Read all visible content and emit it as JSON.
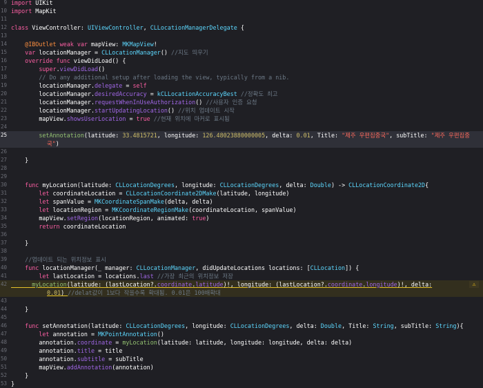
{
  "editor": {
    "lines": [
      {
        "n": "9",
        "t": [
          [
            "kw",
            "import"
          ],
          [
            "pl",
            " UIKit"
          ]
        ]
      },
      {
        "n": "10",
        "t": [
          [
            "kw",
            "import"
          ],
          [
            "pl",
            " MapKit"
          ]
        ]
      },
      {
        "n": "11",
        "t": []
      },
      {
        "n": "12",
        "t": [
          [
            "kw",
            "class"
          ],
          [
            "pl",
            " ViewController: "
          ],
          [
            "ty",
            "UIViewController"
          ],
          [
            "pl",
            ", "
          ],
          [
            "ty",
            "CLLocationManagerDelegate"
          ],
          [
            "pl",
            " {"
          ]
        ]
      },
      {
        "n": "13",
        "t": []
      },
      {
        "n": "14",
        "t": [
          [
            "pl",
            "    "
          ],
          [
            "attr",
            "@IBOutlet"
          ],
          [
            "pl",
            " "
          ],
          [
            "kw",
            "weak"
          ],
          [
            "pl",
            " "
          ],
          [
            "kw",
            "var"
          ],
          [
            "pl",
            " mapView: "
          ],
          [
            "ty",
            "MKMapView"
          ],
          [
            "pl",
            "!"
          ]
        ]
      },
      {
        "n": "15",
        "t": [
          [
            "pl",
            "    "
          ],
          [
            "kw",
            "var"
          ],
          [
            "pl",
            " locationManager = "
          ],
          [
            "ty",
            "CLLocationManager"
          ],
          [
            "pl",
            "() "
          ],
          [
            "cm",
            "//지도 띄우기"
          ]
        ]
      },
      {
        "n": "16",
        "t": [
          [
            "pl",
            "    "
          ],
          [
            "kw",
            "override"
          ],
          [
            "pl",
            " "
          ],
          [
            "kw",
            "func"
          ],
          [
            "pl",
            " viewDidLoad() {"
          ]
        ]
      },
      {
        "n": "17",
        "t": [
          [
            "pl",
            "        "
          ],
          [
            "kw",
            "super"
          ],
          [
            "pl",
            "."
          ],
          [
            "pr",
            "viewDidLoad"
          ],
          [
            "pl",
            "()"
          ]
        ]
      },
      {
        "n": "18",
        "t": [
          [
            "pl",
            "        "
          ],
          [
            "cm",
            "// Do any additional setup after loading the view, typically from a nib."
          ]
        ]
      },
      {
        "n": "19",
        "t": [
          [
            "pl",
            "        locationManager."
          ],
          [
            "pr",
            "delegate"
          ],
          [
            "pl",
            " = "
          ],
          [
            "kw",
            "self"
          ]
        ]
      },
      {
        "n": "20",
        "t": [
          [
            "pl",
            "        locationManager."
          ],
          [
            "pr",
            "desiredAccuracy"
          ],
          [
            "pl",
            " = "
          ],
          [
            "ty",
            "kCLLocationAccuracyBest"
          ],
          [
            "pl",
            " "
          ],
          [
            "cm",
            "//정확도 최고"
          ]
        ]
      },
      {
        "n": "21",
        "t": [
          [
            "pl",
            "        locationManager."
          ],
          [
            "pr",
            "requestWhenInUseAuthorization"
          ],
          [
            "pl",
            "() "
          ],
          [
            "cm",
            "//사용자 인증 요청"
          ]
        ]
      },
      {
        "n": "22",
        "t": [
          [
            "pl",
            "        locationManager."
          ],
          [
            "pr",
            "startUpdatingLocation"
          ],
          [
            "pl",
            "() "
          ],
          [
            "cm",
            "//위치 업데이트 시작"
          ]
        ]
      },
      {
        "n": "23",
        "t": [
          [
            "pl",
            "        mapView."
          ],
          [
            "pr",
            "showsUserLocation"
          ],
          [
            "pl",
            " = "
          ],
          [
            "kw",
            "true"
          ],
          [
            "pl",
            " "
          ],
          [
            "cm",
            "//현재 위치에 마커로 표시됨"
          ]
        ]
      },
      {
        "n": "24",
        "t": []
      },
      {
        "n": "25",
        "current": true,
        "t": [
          [
            "pl",
            "        "
          ],
          [
            "ck",
            "setAnnotation"
          ],
          [
            "pl",
            "(latitude: "
          ],
          [
            "num",
            "33.4815721"
          ],
          [
            "pl",
            ", longitude: "
          ],
          [
            "num",
            "126.48023880000005"
          ],
          [
            "pl",
            ", delta: "
          ],
          [
            "num",
            "0.01"
          ],
          [
            "pl",
            ", Title: "
          ],
          [
            "str",
            "\"제주 우편집중국\""
          ],
          [
            "pl",
            ", subTitle: "
          ],
          [
            "str",
            "\"제주 우편집중"
          ]
        ]
      },
      {
        "n": "",
        "current": true,
        "wrap": true,
        "t": [
          [
            "str",
            "국\""
          ],
          [
            "pl",
            ")"
          ]
        ]
      },
      {
        "n": "26",
        "t": []
      },
      {
        "n": "27",
        "t": [
          [
            "pl",
            "    }"
          ]
        ]
      },
      {
        "n": "28",
        "t": []
      },
      {
        "n": "29",
        "t": []
      },
      {
        "n": "30",
        "t": [
          [
            "pl",
            "    "
          ],
          [
            "kw",
            "func"
          ],
          [
            "pl",
            " myLocation(latitude: "
          ],
          [
            "ty",
            "CLLocationDegrees"
          ],
          [
            "pl",
            ", longitude: "
          ],
          [
            "ty",
            "CLLocationDegrees"
          ],
          [
            "pl",
            ", delta: "
          ],
          [
            "ty",
            "Double"
          ],
          [
            "pl",
            ") -> "
          ],
          [
            "ty",
            "CLLocationCoordinate2D"
          ],
          [
            "pl",
            "{"
          ]
        ]
      },
      {
        "n": "31",
        "t": [
          [
            "pl",
            "        "
          ],
          [
            "kw",
            "let"
          ],
          [
            "pl",
            " coordinateLocation = "
          ],
          [
            "ty",
            "CLLocationCoordinate2DMake"
          ],
          [
            "pl",
            "(latitude, longitude)"
          ]
        ]
      },
      {
        "n": "32",
        "t": [
          [
            "pl",
            "        "
          ],
          [
            "kw",
            "let"
          ],
          [
            "pl",
            " spanValue = "
          ],
          [
            "ty",
            "MKCoordinateSpanMake"
          ],
          [
            "pl",
            "(delta, delta)"
          ]
        ]
      },
      {
        "n": "33",
        "t": [
          [
            "pl",
            "        "
          ],
          [
            "kw",
            "let"
          ],
          [
            "pl",
            " locationRegion = "
          ],
          [
            "ty",
            "MKCoordinateRegionMake"
          ],
          [
            "pl",
            "(coordinateLocation, spanValue)"
          ]
        ]
      },
      {
        "n": "34",
        "t": [
          [
            "pl",
            "        mapView."
          ],
          [
            "pr",
            "setRegion"
          ],
          [
            "pl",
            "(locationRegion, animated: "
          ],
          [
            "kw",
            "true"
          ],
          [
            "pl",
            ")"
          ]
        ]
      },
      {
        "n": "35",
        "t": [
          [
            "pl",
            "        "
          ],
          [
            "kw",
            "return"
          ],
          [
            "pl",
            " coordinateLocation"
          ]
        ]
      },
      {
        "n": "36",
        "t": []
      },
      {
        "n": "37",
        "t": [
          [
            "pl",
            "    }"
          ]
        ]
      },
      {
        "n": "38",
        "t": []
      },
      {
        "n": "39",
        "t": [
          [
            "pl",
            "    "
          ],
          [
            "cm",
            "//업데이트 되는 위치정보 표시"
          ]
        ]
      },
      {
        "n": "40",
        "t": [
          [
            "pl",
            "    "
          ],
          [
            "kw",
            "func"
          ],
          [
            "pl",
            " locationManager(_ manager: "
          ],
          [
            "ty",
            "CLLocationManager"
          ],
          [
            "pl",
            ", didUpdateLocations locations: ["
          ],
          [
            "ty",
            "CLLocation"
          ],
          [
            "pl",
            "]) {"
          ]
        ]
      },
      {
        "n": "41",
        "t": [
          [
            "pl",
            "        "
          ],
          [
            "kw",
            "let"
          ],
          [
            "pl",
            " lastLocation = locations."
          ],
          [
            "pr",
            "last"
          ],
          [
            "pl",
            " "
          ],
          [
            "cm",
            "//가장 최근의 위치정보 저장"
          ]
        ]
      },
      {
        "n": "42",
        "warn": true,
        "t": [
          [
            "ck",
            "      myLocation"
          ],
          [
            "pl",
            "(latitude: (lastLocation?."
          ],
          [
            "pr",
            "coordinate"
          ],
          [
            "pl",
            "."
          ],
          [
            "pr",
            "latitude"
          ],
          [
            "pl",
            ")!, longitude: (lastLocation?."
          ],
          [
            "pr",
            "coordinate"
          ],
          [
            "pl",
            "."
          ],
          [
            "pr",
            "longitude"
          ],
          [
            "pl",
            ")!, delta:"
          ]
        ]
      },
      {
        "n": "",
        "warn": true,
        "wrap": true,
        "t": [
          [
            "num",
            "0.01"
          ],
          [
            "pl",
            ") "
          ],
          [
            "cm",
            "//delat값이 1보다 작을수록 확대됨. 0.01은 100배확대"
          ]
        ]
      },
      {
        "n": "43",
        "t": []
      },
      {
        "n": "44",
        "t": [
          [
            "pl",
            "    }"
          ]
        ]
      },
      {
        "n": "45",
        "t": []
      },
      {
        "n": "46",
        "t": [
          [
            "pl",
            "    "
          ],
          [
            "kw",
            "func"
          ],
          [
            "pl",
            " setAnnotation(latitude: "
          ],
          [
            "ty",
            "CLLocationDegrees"
          ],
          [
            "pl",
            ", longitude: "
          ],
          [
            "ty",
            "CLLocationDegrees"
          ],
          [
            "pl",
            ", delta: "
          ],
          [
            "ty",
            "Double"
          ],
          [
            "pl",
            ", Title: "
          ],
          [
            "ty",
            "String"
          ],
          [
            "pl",
            ", subTitle: "
          ],
          [
            "ty",
            "String"
          ],
          [
            "pl",
            "){"
          ]
        ]
      },
      {
        "n": "47",
        "t": [
          [
            "pl",
            "        "
          ],
          [
            "kw",
            "let"
          ],
          [
            "pl",
            " annotation = "
          ],
          [
            "ty",
            "MKPointAnnotation"
          ],
          [
            "pl",
            "()"
          ]
        ]
      },
      {
        "n": "48",
        "t": [
          [
            "pl",
            "        annotation."
          ],
          [
            "pr",
            "coordinate"
          ],
          [
            "pl",
            " = "
          ],
          [
            "ck",
            "myLocation"
          ],
          [
            "pl",
            "(latitude: latitude, longitude: longitude, delta: delta)"
          ]
        ]
      },
      {
        "n": "49",
        "t": [
          [
            "pl",
            "        annotation."
          ],
          [
            "pr",
            "title"
          ],
          [
            "pl",
            " = title"
          ]
        ]
      },
      {
        "n": "50",
        "t": [
          [
            "pl",
            "        annotation."
          ],
          [
            "pr",
            "subtitle"
          ],
          [
            "pl",
            " = subTitle"
          ]
        ]
      },
      {
        "n": "51",
        "t": [
          [
            "pl",
            "        mapView."
          ],
          [
            "pr",
            "addAnnotation"
          ],
          [
            "pl",
            "(annotation)"
          ]
        ]
      },
      {
        "n": "52",
        "t": [
          [
            "pl",
            "    }"
          ]
        ]
      },
      {
        "n": "53",
        "t": [
          [
            "pl",
            "}"
          ]
        ]
      }
    ],
    "warning_icon": "warning-triangle-icon",
    "warning_glyph": "⚠"
  },
  "colors": {
    "background": "#1f1f24",
    "keyword": "#fc5fa3",
    "type": "#5dd8ff",
    "property": "#a167e6",
    "string": "#fc6a5d",
    "number": "#d0bf69",
    "comment": "#6c7986",
    "project_function": "#94c271",
    "attribute": "#fd8f3f"
  }
}
